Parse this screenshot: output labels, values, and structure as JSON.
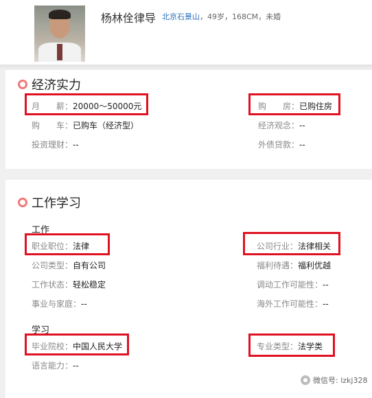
{
  "profile": {
    "name": "杨林佺律导",
    "location": "北京石景山",
    "details": "，49岁，168CM，未婚"
  },
  "economy": {
    "title": "经济实力",
    "rows": [
      {
        "label": "月　　薪：",
        "value": "20000～50000元"
      },
      {
        "label": "购　　房：",
        "value": "已购住房"
      },
      {
        "label": "购　　车：",
        "value": "已购车（经济型）"
      },
      {
        "label": "经济观念：",
        "value": "--"
      },
      {
        "label": "投资理财：",
        "value": "--"
      },
      {
        "label": "外债贷款：",
        "value": "--"
      }
    ]
  },
  "work_study": {
    "title": "工作学习",
    "work_title": "工作",
    "work_rows": [
      {
        "label": "职业职位：",
        "value": "法律"
      },
      {
        "label": "公司行业：",
        "value": "法律相关"
      },
      {
        "label": "公司类型：",
        "value": "自有公司"
      },
      {
        "label": "福利待遇：",
        "value": "福利优越"
      },
      {
        "label": "工作状态：",
        "value": "轻松稳定"
      },
      {
        "label": "调动工作可能性：",
        "value": "--"
      },
      {
        "label": "事业与家庭：",
        "value": "--"
      },
      {
        "label": "海外工作可能性：",
        "value": "--"
      }
    ],
    "study_title": "学习",
    "study_rows": [
      {
        "label": "毕业院校：",
        "value": "中国人民大学"
      },
      {
        "label": "专业类型：",
        "value": "法学类"
      },
      {
        "label": "语言能力：",
        "value": "--"
      }
    ]
  },
  "watermark": {
    "text": "微信号: lzkj328",
    "icon": "wechat-icon"
  },
  "colors": {
    "highlight": "#e01020",
    "section_dot": "#f27777",
    "location_link": "#2a6ebb"
  }
}
